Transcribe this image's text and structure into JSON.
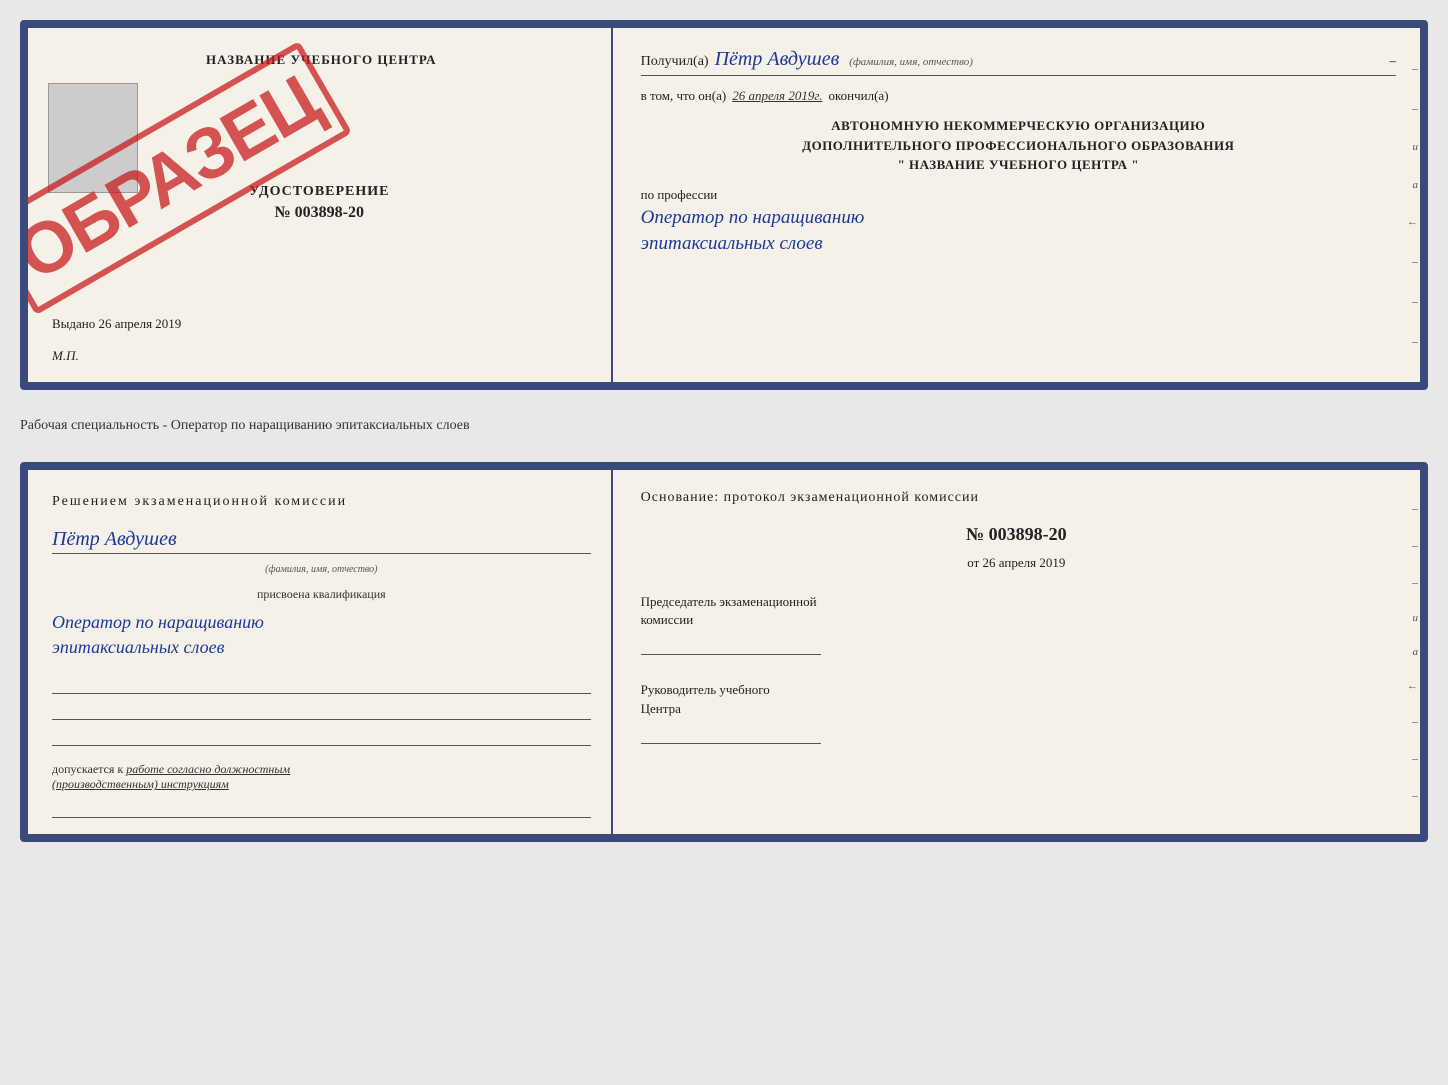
{
  "page": {
    "background": "#e8e8e8"
  },
  "top_cert": {
    "left": {
      "title": "НАЗВАНИЕ УЧЕБНОГО ЦЕНТРА",
      "stamp": "ОБРАЗЕЦ",
      "udostoverenie_label": "УДОСТОВЕРЕНИЕ",
      "udostoverenie_num": "№ 003898-20",
      "vydano_label": "Выдано",
      "vydano_date": "26 апреля 2019",
      "mp_label": "М.П."
    },
    "right": {
      "poluchil_label": "Получил(а)",
      "recipient_name": "Пётр Авдушев",
      "fio_hint": "(фамилия, имя, отчество)",
      "vtom_label": "в том, что он(а)",
      "date": "26 апреля 2019г.",
      "okonchil_label": "окончил(а)",
      "org_line1": "АВТОНОМНУЮ НЕКОММЕРЧЕСКУЮ ОРГАНИЗАЦИЮ",
      "org_line2": "ДОПОЛНИТЕЛЬНОГО ПРОФЕССИОНАЛЬНОГО ОБРАЗОВАНИЯ",
      "org_name": "\" НАЗВАНИЕ УЧЕБНОГО ЦЕНТРА \"",
      "po_professii_label": "по профессии",
      "profession": "Оператор по наращиванию\nэпитаксиальных слоев"
    }
  },
  "middle_text": "Рабочая специальность - Оператор по наращиванию эпитаксиальных слоев",
  "bottom_cert": {
    "left": {
      "resheniem_label": "Решением экзаменационной комиссии",
      "recipient_name": "Пётр Авдушев",
      "fio_hint": "(фамилия, имя, отчество)",
      "prisvoena_label": "присвоена квалификация",
      "qualification": "Оператор по наращиванию\nэпитаксиальных слоев",
      "dopuskaetsya_label": "допускается к",
      "dopuskaetsya_text": "работе согласно должностным\n(производственным) инструкциям"
    },
    "right": {
      "osnovanie_label": "Основание: протокол экзаменационной комиссии",
      "protocol_num": "№ 003898-20",
      "ot_label": "от",
      "protocol_date": "26 апреля 2019",
      "predsedatel_label": "Председатель экзаменационной\nкомиссии",
      "rukovoditel_label": "Руководитель учебного\nЦентра"
    }
  }
}
